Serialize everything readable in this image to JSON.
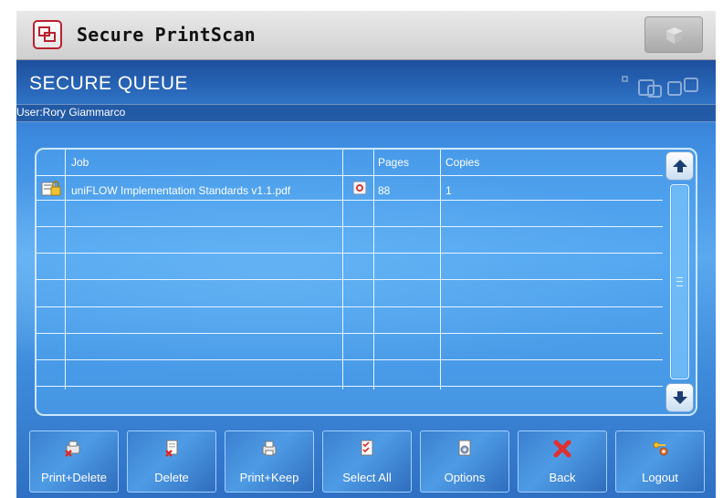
{
  "app": {
    "title": "Secure PrintScan"
  },
  "header": {
    "title": "SECURE QUEUE",
    "user": "User:Rory Giammarco"
  },
  "table": {
    "columns": [
      "Job",
      "Pages",
      "Copies"
    ],
    "rows": [
      {
        "job": "uniFLOW Implementation Standards v1.1.pdf",
        "pages": "88",
        "copies": "1"
      }
    ]
  },
  "buttons": [
    {
      "label": "Print+Delete",
      "icon": "print-delete-icon"
    },
    {
      "label": "Delete",
      "icon": "delete-icon"
    },
    {
      "label": "Print+Keep",
      "icon": "print-keep-icon"
    },
    {
      "label": "Select All",
      "icon": "select-all-icon"
    },
    {
      "label": "Options",
      "icon": "options-icon"
    },
    {
      "label": "Back",
      "icon": "back-icon"
    },
    {
      "label": "Logout",
      "icon": "logout-icon"
    }
  ],
  "colors": {
    "brand_red": "#b9212f",
    "panel_blue": "#3d8be0",
    "header_blue": "#1d4f9d"
  }
}
